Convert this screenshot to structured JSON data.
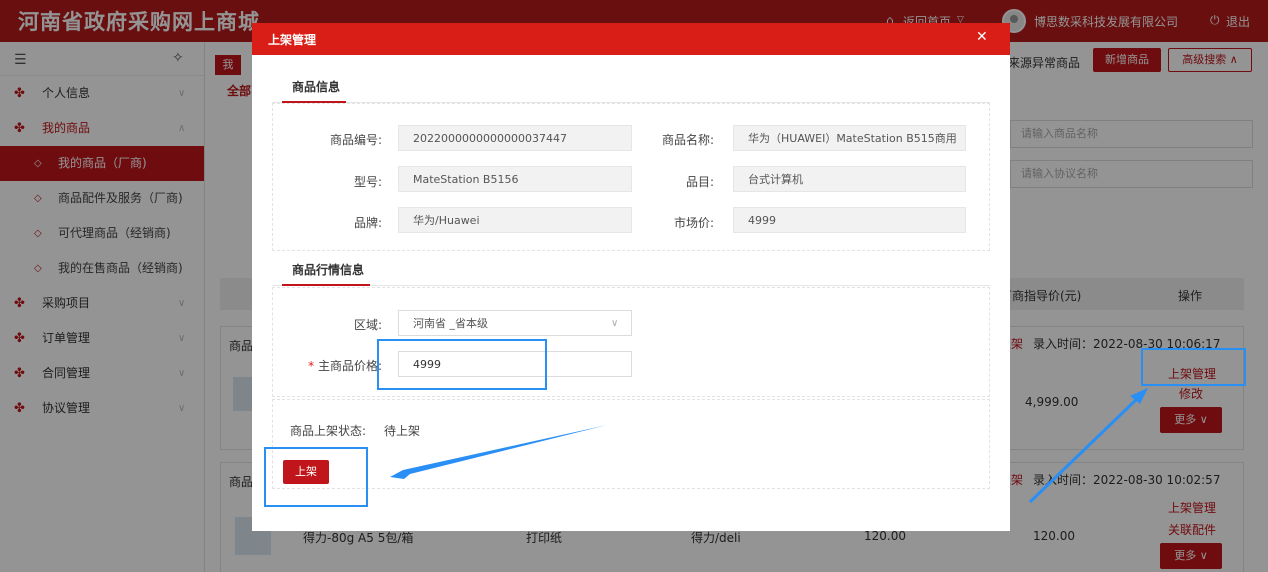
{
  "header": {
    "site_title": "河南省政府采购网上商城",
    "home_link": "返回首页",
    "company": "博思数采科技发展有限公司",
    "logout": "退出"
  },
  "sidebar": {
    "items": [
      {
        "label": "个人信息"
      },
      {
        "label": "我的商品"
      },
      {
        "label": "采购项目"
      },
      {
        "label": "订单管理"
      },
      {
        "label": "合同管理"
      },
      {
        "label": "协议管理"
      }
    ],
    "sub_items": [
      {
        "label": "我的商品（厂商)"
      },
      {
        "label": "商品配件及服务（厂商)"
      },
      {
        "label": "可代理商品（经销商)"
      },
      {
        "label": "我的在售商品（经销商)"
      }
    ]
  },
  "background": {
    "tab_label": "我",
    "all_tab": "全部",
    "abnormal_link": "来源异常商品",
    "add_button": "新增商品",
    "advanced_search": "高级搜索",
    "name_placeholder": "请输入商品名称",
    "agreement_placeholder": "请输入协议名称",
    "table_headers": {
      "guide_price": "厂商指导价(元)",
      "ops": "操作"
    },
    "rows": [
      {
        "status_line": "上架",
        "entry_time": "录入时间：2022-08-30 10:06:17",
        "guide_price": "4,999.00",
        "ops": [
          "上架管理",
          "修改"
        ],
        "more": "更多"
      },
      {
        "status_line": "上架",
        "entry_time": "录入时间：2022-08-30 10:02:57",
        "name": "得力-80g A5 5包/箱",
        "category": "打印纸",
        "brand": "得力/deli",
        "price": "120.00",
        "guide_price": "120.00",
        "ops": [
          "上架管理",
          "关联配件"
        ],
        "more": "更多"
      }
    ],
    "row_label": "商品"
  },
  "modal": {
    "title": "上架管理",
    "section_product": "商品信息",
    "section_market": "商品行情信息",
    "fields": {
      "code_label": "商品编号:",
      "code_value": "2022000000000000037447",
      "name_label": "商品名称:",
      "name_value": "华为（HUAWEI）MateStation B515商用",
      "model_label": "型号:",
      "model_value": "MateStation B5156",
      "category_label": "品目:",
      "category_value": "台式计算机",
      "brand_label": "品牌:",
      "brand_value": "华为/Huawei",
      "market_price_label": "市场价:",
      "market_price_value": "4999"
    },
    "market": {
      "region_label": "区域:",
      "region_value": "河南省 _省本级",
      "main_price_label": "主商品价格:",
      "main_price_value": "4999",
      "required_mark": "*"
    },
    "status_label": "商品上架状态:",
    "status_value": "待上架",
    "publish_button": "上架"
  },
  "annotation_color": "#2a8ff5",
  "accent_color": "#c0161b"
}
